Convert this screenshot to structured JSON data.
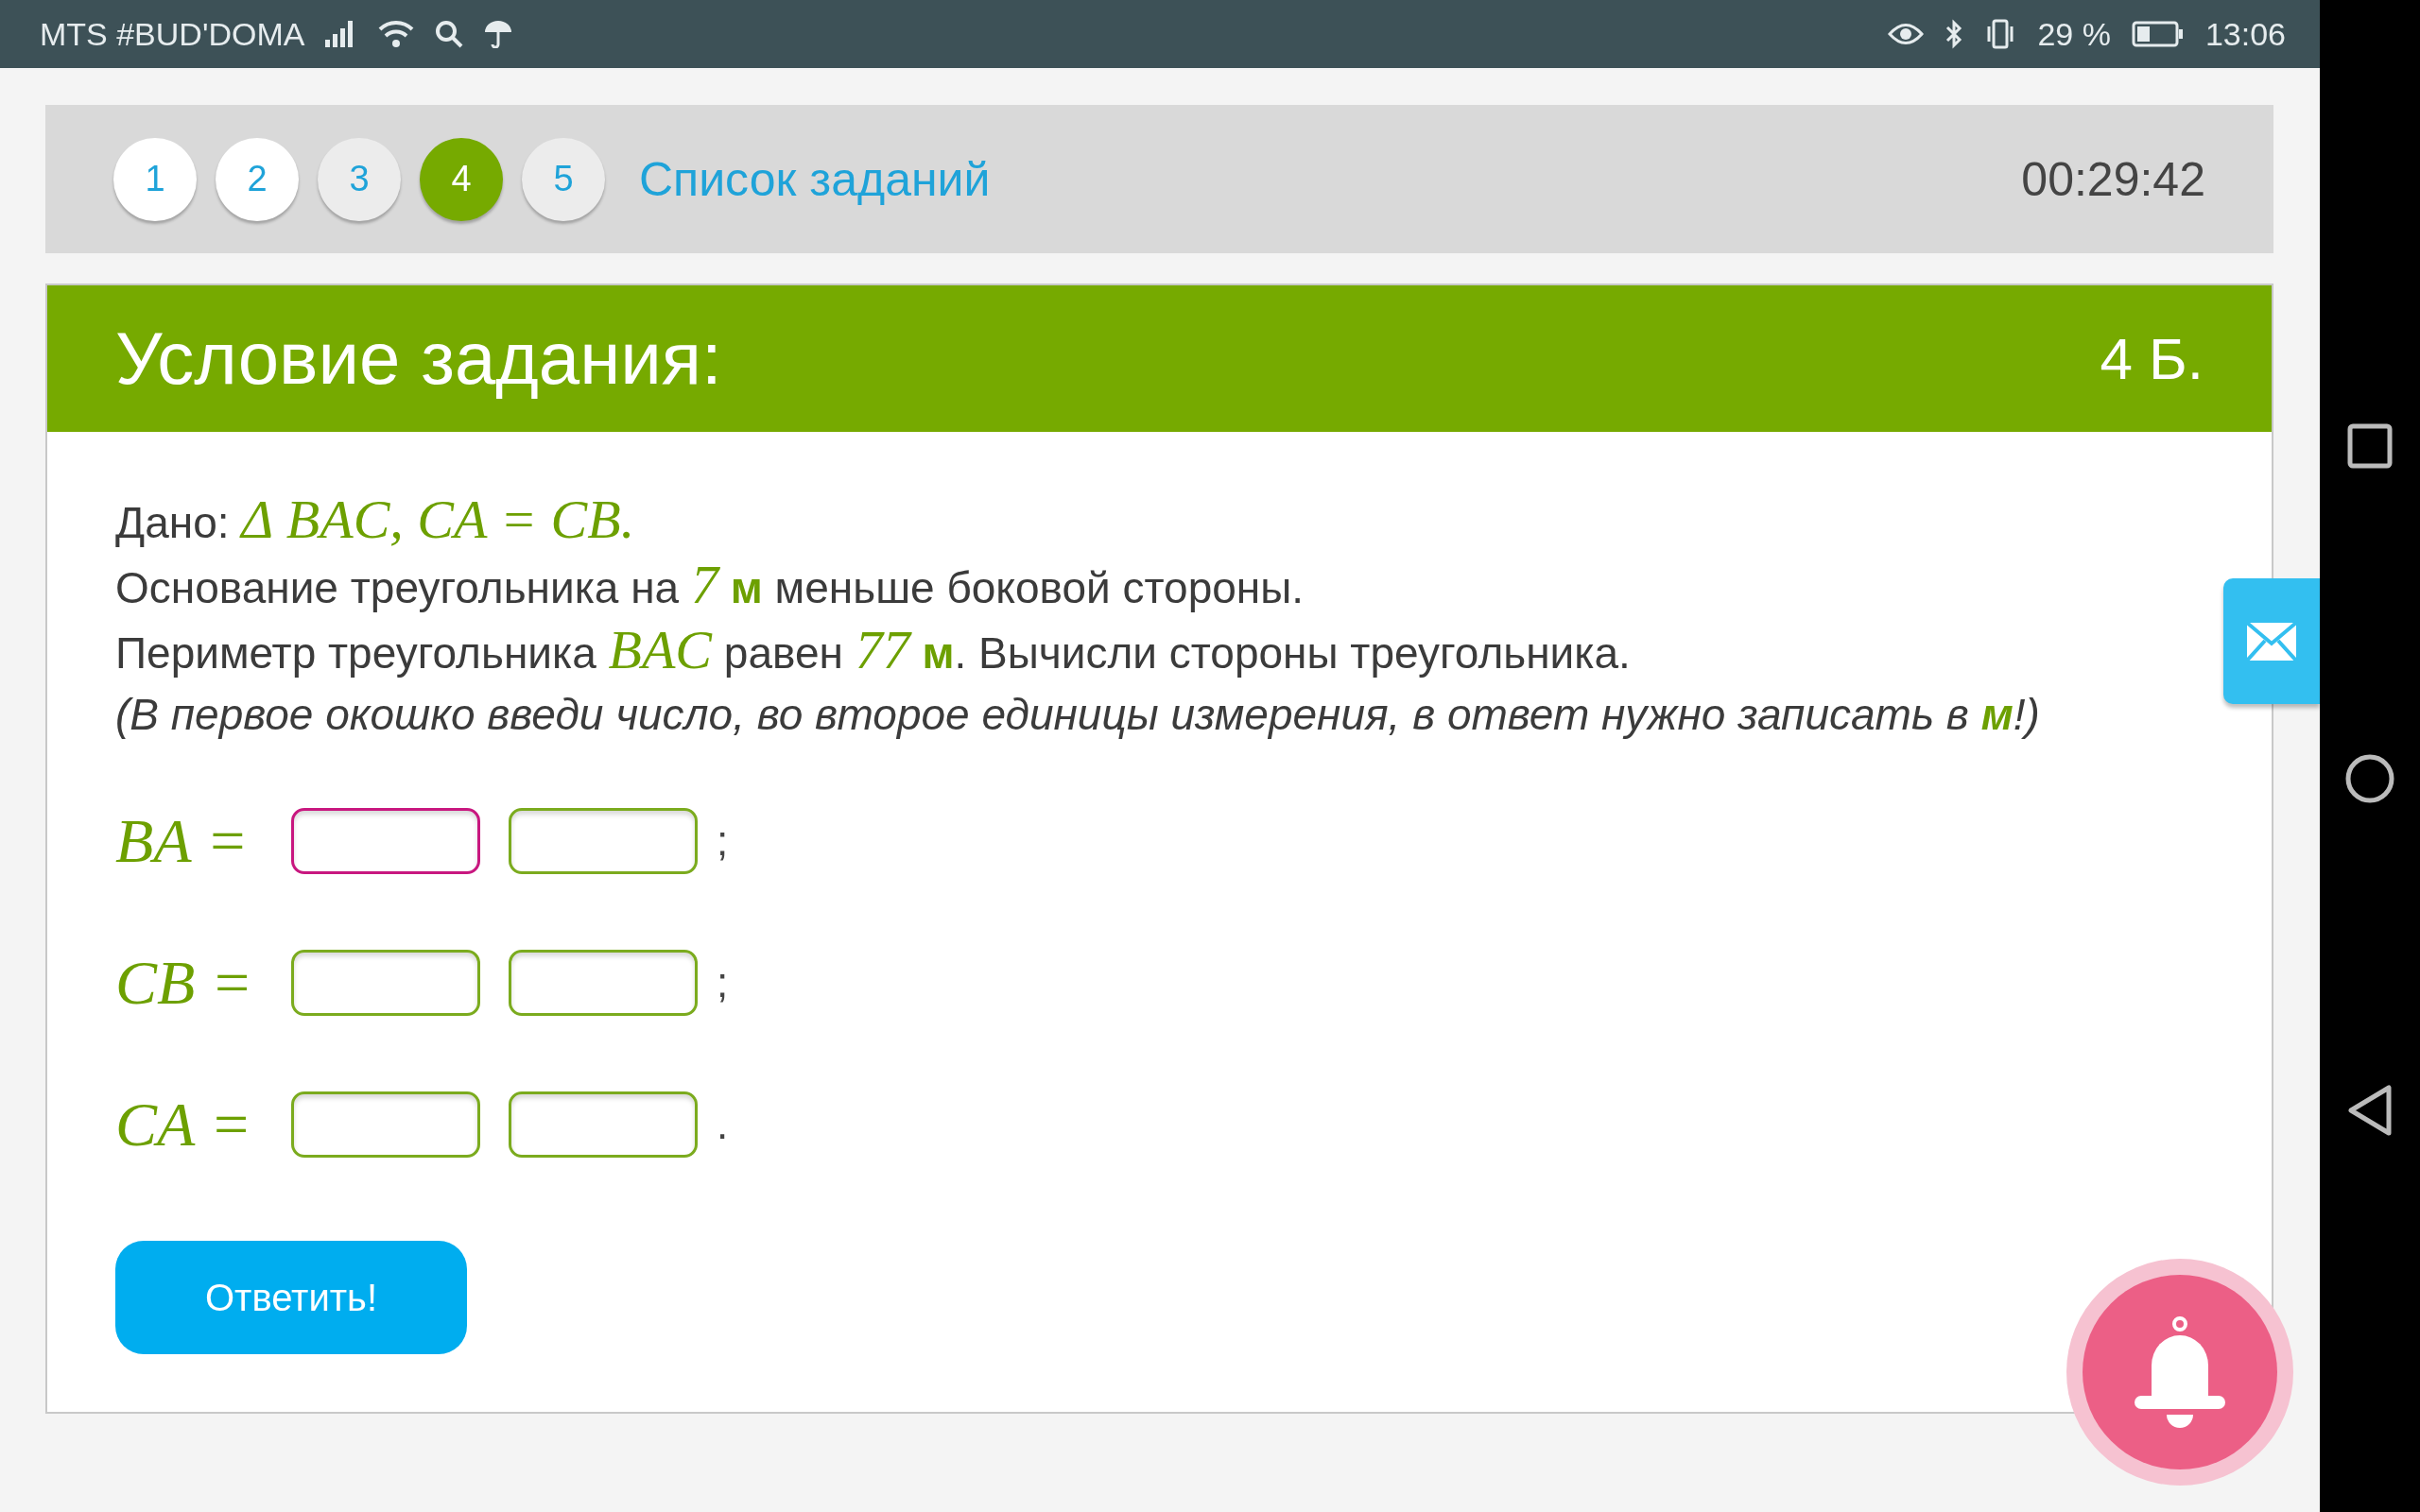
{
  "status_bar": {
    "carrier": "MTS #BUD'DOMA",
    "battery": "29 %",
    "time": "13:06"
  },
  "task_nav": {
    "pages": [
      {
        "label": "1",
        "selected": false,
        "answered": true
      },
      {
        "label": "2",
        "selected": false,
        "answered": true
      },
      {
        "label": "3",
        "selected": false,
        "answered": false
      },
      {
        "label": "4",
        "selected": true,
        "answered": false
      },
      {
        "label": "5",
        "selected": false,
        "answered": false
      }
    ],
    "list_link": "Список заданий",
    "timer": "00:29:42"
  },
  "task": {
    "title": "Условие задания:",
    "points": "4 Б.",
    "statement": [
      {
        "italic": false,
        "parts": [
          {
            "kind": "text",
            "text": "Дано: "
          },
          {
            "kind": "math",
            "text": "Δ BAC, CA = CB."
          }
        ]
      },
      {
        "italic": false,
        "parts": [
          {
            "kind": "text",
            "text": "Основание треугольника на "
          },
          {
            "kind": "math",
            "text": "7"
          },
          {
            "kind": "accent",
            "text": " м"
          },
          {
            "kind": "text",
            "text": " меньше боковой стороны."
          }
        ]
      },
      {
        "italic": false,
        "parts": [
          {
            "kind": "text",
            "text": "Периметр треугольника "
          },
          {
            "kind": "math",
            "text": "BAC"
          },
          {
            "kind": "text",
            "text": " равен "
          },
          {
            "kind": "math",
            "text": "77"
          },
          {
            "kind": "accent",
            "text": " м"
          },
          {
            "kind": "text",
            "text": ". Вычисли стороны треугольника."
          }
        ]
      },
      {
        "italic": true,
        "parts": [
          {
            "kind": "text",
            "text": "(В первое окошко введи число, во второе единицы измерения, в ответ нужно записать в "
          },
          {
            "kind": "accent",
            "text": "м"
          },
          {
            "kind": "text",
            "text": "!)"
          }
        ]
      }
    ],
    "answers": [
      {
        "label": "BA =",
        "inputs": [
          {
            "focused": true
          },
          {
            "focused": false
          }
        ],
        "end": ";"
      },
      {
        "label": "CB =",
        "inputs": [
          {
            "focused": false
          },
          {
            "focused": false
          }
        ],
        "end": ";"
      },
      {
        "label": "CA =",
        "inputs": [
          {
            "focused": false
          },
          {
            "focused": false
          }
        ],
        "end": "."
      }
    ],
    "submit": "Ответить!"
  }
}
